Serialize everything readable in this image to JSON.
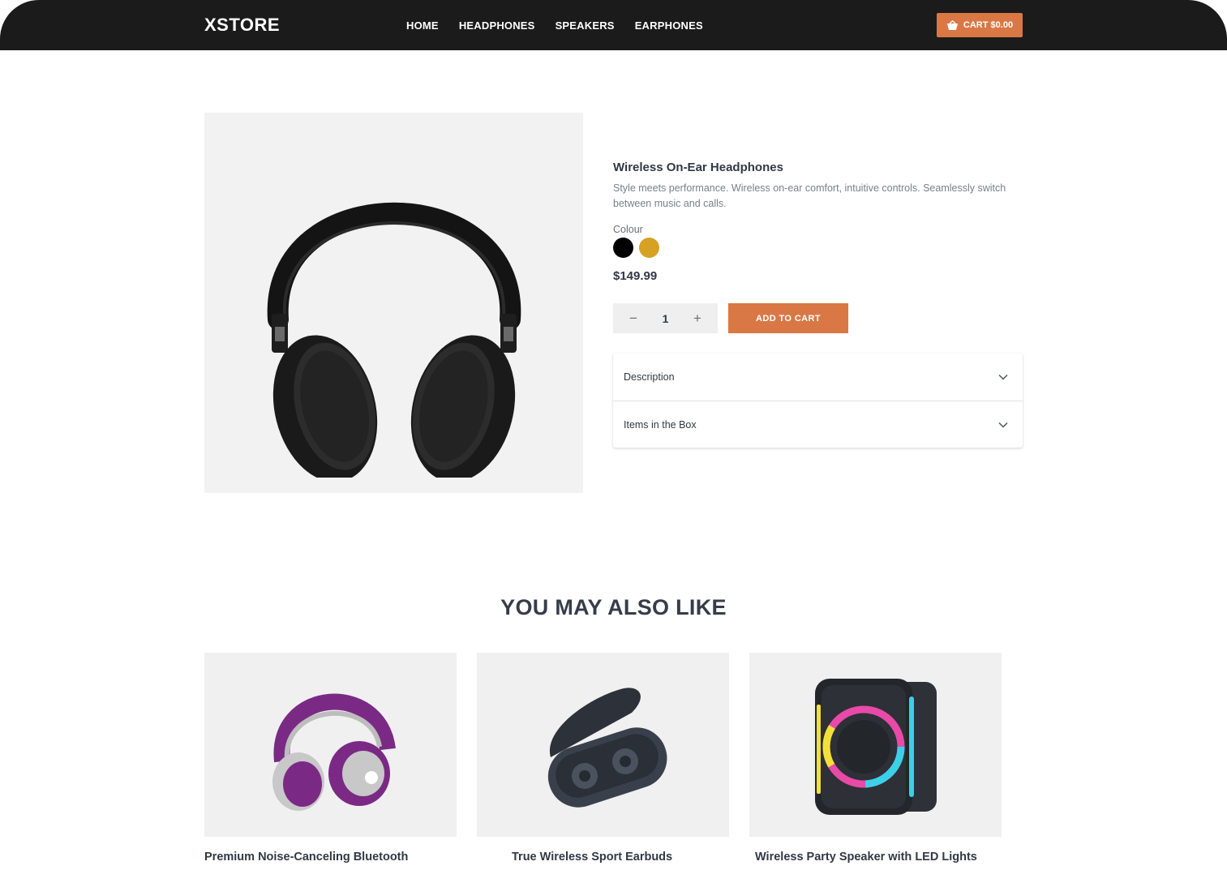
{
  "header": {
    "logo": "XSTORE",
    "nav": [
      "HOME",
      "HEADPHONES",
      "SPEAKERS",
      "EARPHONES"
    ],
    "cart_label": "CART $0.00"
  },
  "product": {
    "title": "Wireless On-Ear Headphones",
    "description": "Style meets performance. Wireless on-ear comfort, intuitive controls. Seamlessly switch between music and calls.",
    "colour_label": "Colour",
    "colours": [
      "#000000",
      "#d7a123"
    ],
    "price": "$149.99",
    "quantity": "1",
    "add_to_cart": "ADD TO CART",
    "accordion": [
      "Description",
      "Items in the Box"
    ]
  },
  "related": {
    "title": "YOU MAY ALSO LIKE",
    "items": [
      {
        "name": "Premium Noise-Canceling Bluetooth"
      },
      {
        "name": "True Wireless Sport Earbuds"
      },
      {
        "name": "Wireless Party Speaker with LED Lights"
      }
    ]
  },
  "colors": {
    "accent": "#d97845",
    "header_bg": "#1b1b1b"
  }
}
